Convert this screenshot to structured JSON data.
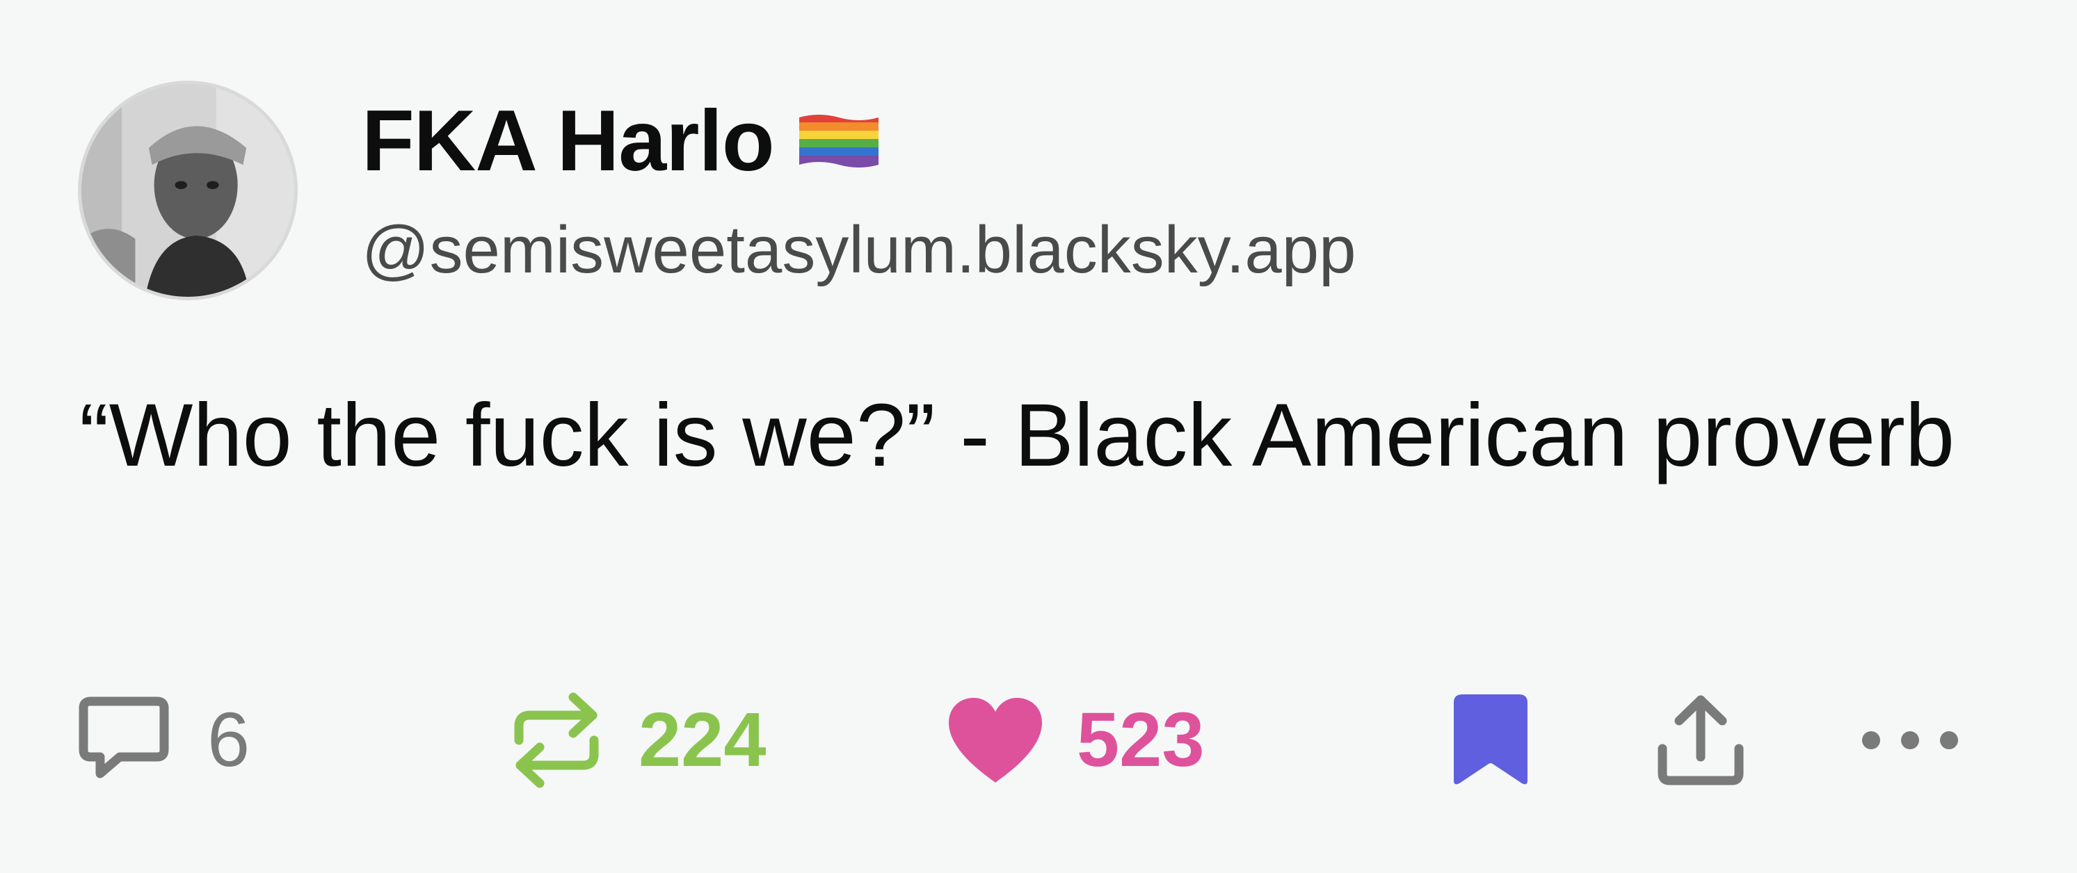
{
  "author": {
    "display_name": "FKA Harlo",
    "flag_emoji": "🏳️‍🌈",
    "handle": "@semisweetasylum.blacksky.app"
  },
  "post": {
    "text": "“Who the fuck is we?” - Black American proverb"
  },
  "actions": {
    "reply_count": "6",
    "repost_count": "224",
    "like_count": "523"
  },
  "icons": {
    "reply": "speech-bubble-icon",
    "repost": "repost-arrows-icon",
    "like": "heart-icon",
    "bookmark": "bookmark-icon",
    "share": "share-upload-icon",
    "more": "ellipsis-icon"
  },
  "colors": {
    "background": "#f6f8f7",
    "text": "#0d0d0d",
    "handle": "#4a4a4a",
    "muted": "#7a7a7a",
    "repost_active": "#8ac44e",
    "like_active": "#de529b",
    "bookmark_active": "#5f5fe0"
  }
}
